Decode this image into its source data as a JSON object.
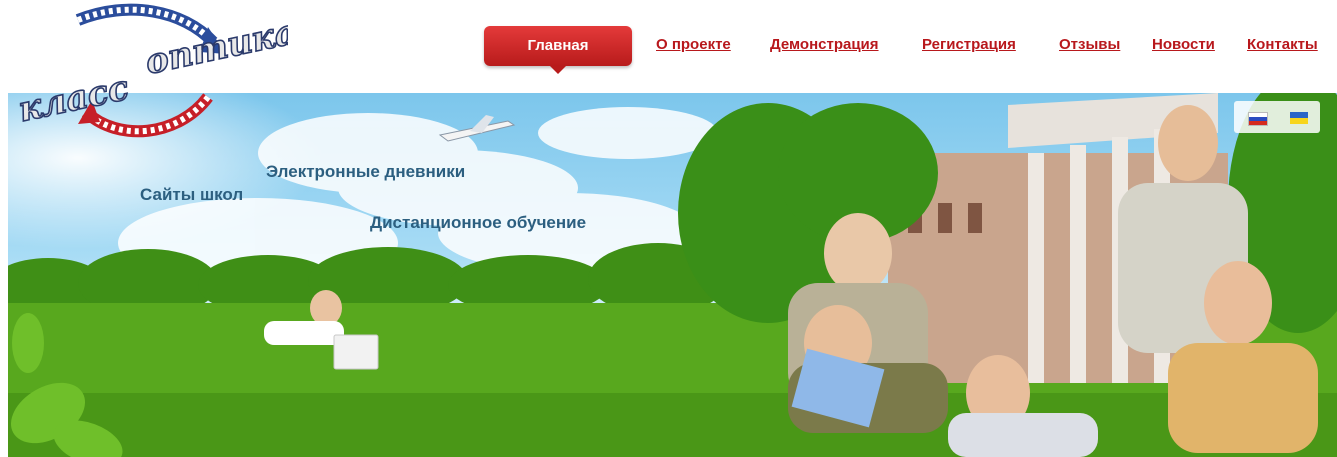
{
  "logo": {
    "line1": "класс",
    "line2": "оптика"
  },
  "nav": {
    "active": "Главная",
    "links": [
      "О проекте",
      "Демонстрация",
      "Регистрация",
      "Отзывы",
      "Новости",
      "Контакты"
    ]
  },
  "banner": {
    "taglines": [
      "Сайты школ",
      "Электронные дневники",
      "Дистанционное обучение"
    ]
  },
  "languages": [
    "russian-flag-icon",
    "ukrainian-flag-icon"
  ],
  "colors": {
    "accent": "#b8181c",
    "nav_active_bg": "#c92424",
    "tagline": "#2c5f80"
  }
}
